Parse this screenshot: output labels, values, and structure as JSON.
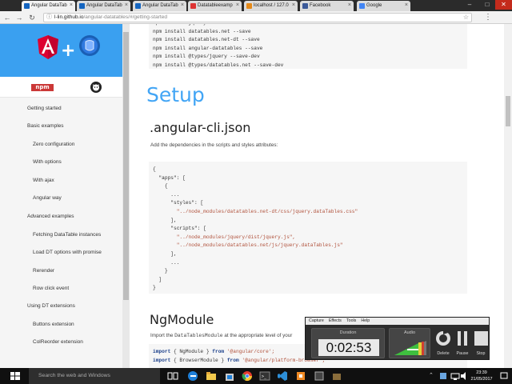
{
  "browser": {
    "tabs": [
      {
        "label": "Angular DataTab",
        "fav_color": "#1565c0"
      },
      {
        "label": "Angular DataTab",
        "fav_color": "#1565c0"
      },
      {
        "label": "Angular DataTab",
        "fav_color": "#1565c0"
      },
      {
        "label": "Datatableexamp",
        "fav_color": "#dd3333"
      },
      {
        "label": "localhost / 127.0",
        "fav_color": "#e58a1a"
      },
      {
        "label": "Facebook",
        "fav_color": "#3b5998"
      },
      {
        "label": "Google",
        "fav_color": "#4285f4"
      }
    ],
    "url_host": "l-lin.github.io",
    "url_path": "/angular-datatables/#/getting-started"
  },
  "sidebar": {
    "items": [
      {
        "label": "Getting started",
        "kind": "cat"
      },
      {
        "label": "Basic examples",
        "kind": "cat"
      },
      {
        "label": "Zero configuration",
        "kind": "sub"
      },
      {
        "label": "With options",
        "kind": "sub"
      },
      {
        "label": "With ajax",
        "kind": "sub"
      },
      {
        "label": "Angular way",
        "kind": "sub"
      },
      {
        "label": "Advanced examples",
        "kind": "cat"
      },
      {
        "label": "Fetching DataTable instances",
        "kind": "sub"
      },
      {
        "label": "Load DT options with promise",
        "kind": "sub"
      },
      {
        "label": "Rerender",
        "kind": "sub"
      },
      {
        "label": "Row click event",
        "kind": "sub"
      },
      {
        "label": "Using DT extensions",
        "kind": "cat"
      },
      {
        "label": "Buttons extension",
        "kind": "sub"
      },
      {
        "label": "ColReorder extension",
        "kind": "sub"
      }
    ],
    "npm_label": "npm"
  },
  "content": {
    "install_lines": [
      "npm install jquery --save",
      "npm install datatables.net --save",
      "npm install datatables.net-dt --save",
      "npm install angular-datatables --save",
      "npm install @types/jquery --save-dev",
      "npm install @types/datatables.net --save-dev"
    ],
    "setup_heading": "Setup",
    "cli_heading": ".angular-cli.json",
    "cli_para": "Add the dependencies in the scripts and styles attributes:",
    "json_lines": [
      "{",
      "  \"apps\": [",
      "    {",
      "      ...",
      "      \"styles\": [",
      "        \"../node_modules/datatables.net-dt/css/jquery.dataTables.css\"",
      "      ],",
      "      \"scripts\": [",
      "        \"../node_modules/jquery/dist/jquery.js\",",
      "        \"../node_modules/datatables.net/js/jquery.dataTables.js\"",
      "      ],",
      "      ...",
      "    }",
      "  ]",
      "}"
    ],
    "module_heading": "NgModule",
    "module_para_pre": "Import the ",
    "module_para_code": "DataTablesModule",
    "module_para_post": " at the appropriate level of your",
    "import_lines": [
      {
        "kw": "import",
        "mid": " { NgModule } ",
        "from": "from",
        "str": " '@angular/core';"
      },
      {
        "kw": "import",
        "mid": " { BrowserModule } ",
        "from": "from",
        "str": " '@angular/platform-browser';"
      }
    ]
  },
  "recorder": {
    "menu": [
      "Capture",
      "Effects",
      "Tools",
      "Help"
    ],
    "duration_label": "Duration",
    "duration": "0:02:53",
    "audio_label": "Audio",
    "buttons": [
      "Delete",
      "Pause",
      "Stop"
    ]
  },
  "taskbar": {
    "search_placeholder": "Search the web and Windows",
    "time": "23:39",
    "date": "21/05/2017"
  }
}
